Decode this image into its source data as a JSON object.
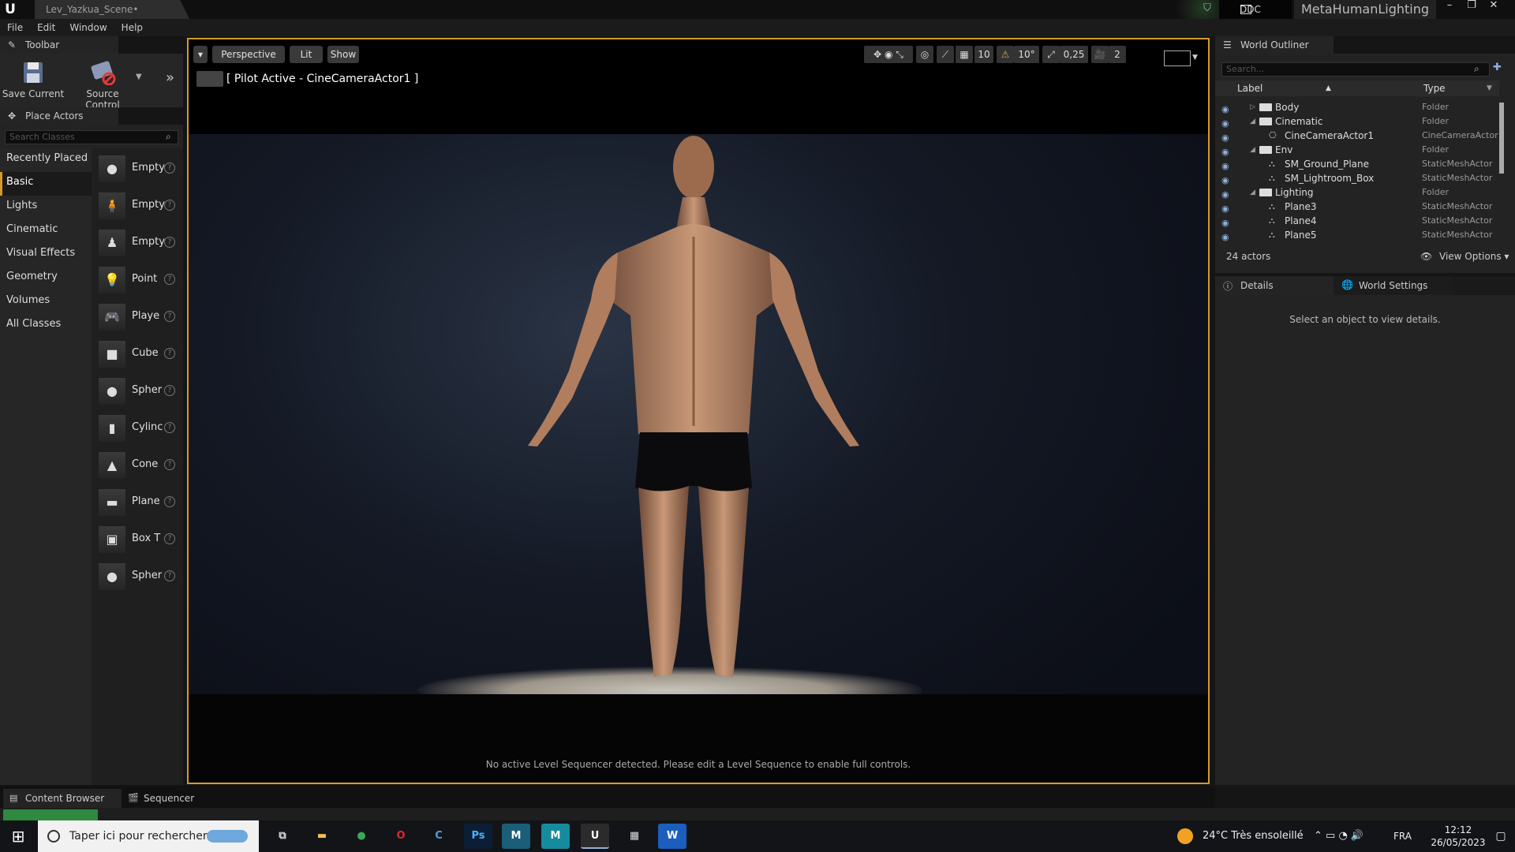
{
  "window": {
    "tab_title": "Lev_Yazkua_Scene•",
    "ddc_label": "DDC",
    "project": "MetaHumanLighting"
  },
  "menu": [
    "File",
    "Edit",
    "Window",
    "Help"
  ],
  "toolbar": {
    "tab": "Toolbar",
    "save_label": "Save Current",
    "source_control_label": "Source Control"
  },
  "place_actors": {
    "tab": "Place Actors",
    "search_placeholder": "Search Classes",
    "categories": [
      "Recently Placed",
      "Basic",
      "Lights",
      "Cinematic",
      "Visual Effects",
      "Geometry",
      "Volumes",
      "All Classes"
    ],
    "active_category": "Basic",
    "items": [
      "Empty",
      "Empty",
      "Empty",
      "Point",
      "Playe",
      "Cube",
      "Spher",
      "Cylinc",
      "Cone",
      "Plane",
      "Box T",
      "Spher"
    ]
  },
  "viewport": {
    "perspective": "Perspective",
    "lit": "Lit",
    "show": "Show",
    "pilot": "[ Pilot Active - CineCameraActor1 ]",
    "grid_snap": "10",
    "rotation_snap": "10°",
    "scale_snap": "0,25",
    "camera_speed": "2",
    "footer": "No active Level Sequencer detected. Please edit a Level Sequence to enable full controls."
  },
  "outliner": {
    "tab": "World Outliner",
    "search_placeholder": "Search...",
    "col_label": "Label",
    "col_type": "Type",
    "rows": [
      {
        "name": "Body",
        "type": "Folder",
        "kind": "folder",
        "depth": 0
      },
      {
        "name": "Cinematic",
        "type": "Folder",
        "kind": "folder",
        "depth": 0
      },
      {
        "name": "CineCameraActor1",
        "type": "CineCameraActor",
        "kind": "actor",
        "depth": 1
      },
      {
        "name": "Env",
        "type": "Folder",
        "kind": "folder",
        "depth": 0
      },
      {
        "name": "SM_Ground_Plane",
        "type": "StaticMeshActor",
        "kind": "actor",
        "depth": 1
      },
      {
        "name": "SM_Lightroom_Box",
        "type": "StaticMeshActor",
        "kind": "actor",
        "depth": 1
      },
      {
        "name": "Lighting",
        "type": "Folder",
        "kind": "folder",
        "depth": 0
      },
      {
        "name": "Plane3",
        "type": "StaticMeshActor",
        "kind": "actor",
        "depth": 1
      },
      {
        "name": "Plane4",
        "type": "StaticMeshActor",
        "kind": "actor",
        "depth": 1
      },
      {
        "name": "Plane5",
        "type": "StaticMeshActor",
        "kind": "actor",
        "depth": 1
      }
    ],
    "count": "24 actors",
    "view_options": "View Options"
  },
  "details": {
    "tab": "Details",
    "world_settings_tab": "World Settings",
    "empty_msg": "Select an object to view details."
  },
  "bottom": {
    "content_browser": "Content Browser",
    "sequencer": "Sequencer"
  },
  "taskbar": {
    "search": "Taper ici pour rechercher",
    "weather": "24°C  Très ensoleillé",
    "lang": "FRA",
    "time": "12:12",
    "date": "26/05/2023",
    "apps": [
      {
        "name": "task-view",
        "label": "⧉",
        "bg": "#131418",
        "fg": "#ddd"
      },
      {
        "name": "file-explorer",
        "label": "▬",
        "bg": "#131418",
        "fg": "#f2c14e"
      },
      {
        "name": "chrome",
        "label": "●",
        "bg": "#131418",
        "fg": "#3aa757"
      },
      {
        "name": "opera",
        "label": "O",
        "bg": "#131418",
        "fg": "#e0262b"
      },
      {
        "name": "ccleaner",
        "label": "C",
        "bg": "#131418",
        "fg": "#4aa3df"
      },
      {
        "name": "photoshop",
        "label": "Ps",
        "bg": "#0b1e36",
        "fg": "#4ab3ff"
      },
      {
        "name": "app-m1",
        "label": "M",
        "bg": "#1b5e7a",
        "fg": "#fff"
      },
      {
        "name": "app-m2",
        "label": "M",
        "bg": "#168b9e",
        "fg": "#fff"
      },
      {
        "name": "unreal",
        "label": "U",
        "bg": "#2b2b2b",
        "fg": "#fff"
      },
      {
        "name": "calculator",
        "label": "▦",
        "bg": "#131418",
        "fg": "#ddd"
      },
      {
        "name": "word",
        "label": "W",
        "bg": "#1b5ebe",
        "fg": "#fff"
      }
    ]
  },
  "colors": {
    "accent": "#d59a2c",
    "panel": "#232323"
  }
}
